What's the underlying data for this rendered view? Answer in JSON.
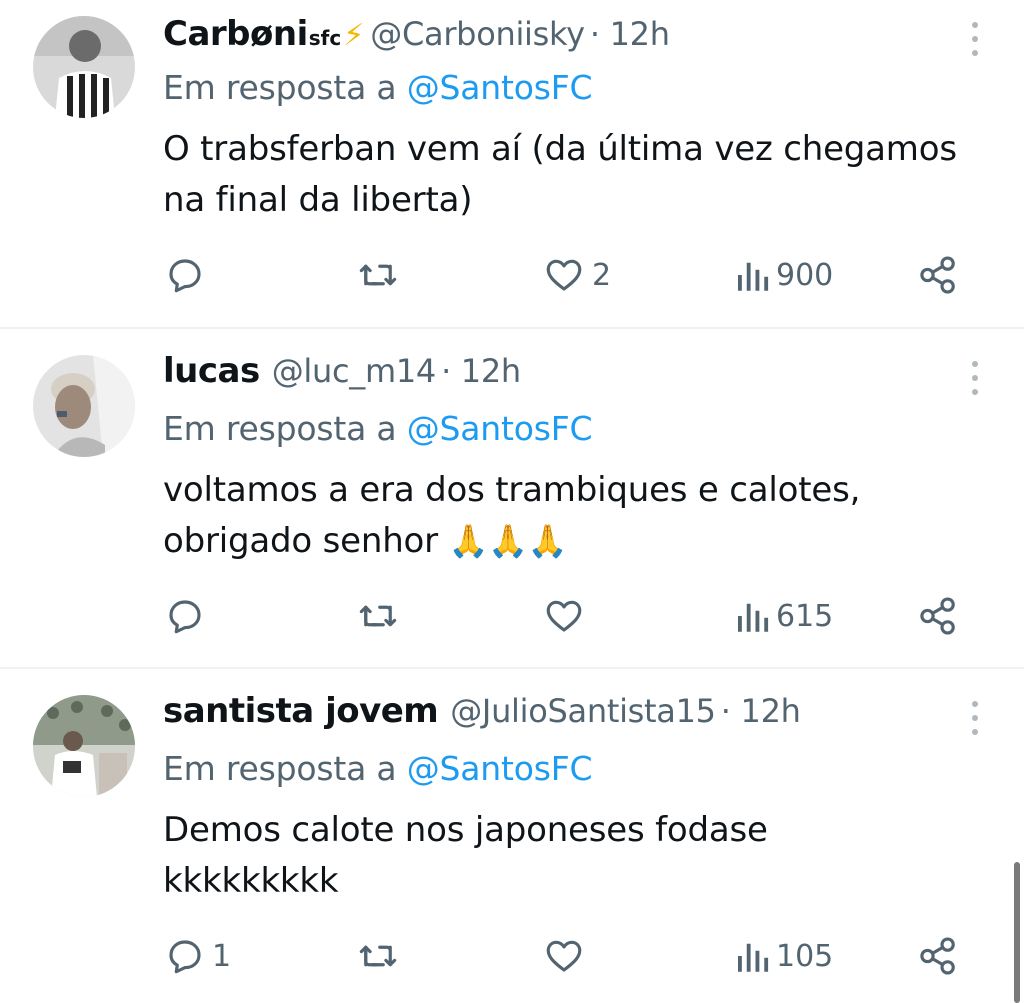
{
  "reply_prefix": "Em resposta a",
  "tweets": [
    {
      "name": "Carbøni",
      "name_sup": "sfc",
      "name_emoji": "⚡",
      "handle": "@Carboniisky",
      "time": "· 12h",
      "reply_to": "@SantosFC",
      "text": "O trabsferban vem aí (da última vez chegamos na final da liberta)",
      "replies": "",
      "retweets": "",
      "likes": "2",
      "views": "900"
    },
    {
      "name": "lucas",
      "handle": "@luc_m14",
      "time": "· 12h",
      "reply_to": "@SantosFC",
      "text": "voltamos a era dos trambiques e calotes, obrigado senhor",
      "text_emoji": "🙏🙏🙏",
      "replies": "",
      "retweets": "",
      "likes": "",
      "views": "615"
    },
    {
      "name": "santista jovem",
      "handle": "@JulioSantista15",
      "time": "· 12h",
      "reply_to": "@SantosFC",
      "text": "Demos calote nos japoneses fodase kkkkkkkkk",
      "replies": "1",
      "retweets": "",
      "likes": "",
      "views": "105"
    }
  ],
  "icons": [
    "reply-icon",
    "retweet-icon",
    "like-icon",
    "views-icon",
    "share-icon",
    "more-options-icon"
  ],
  "colors": {
    "mention": "#1d9bf0",
    "secondary": "#536471",
    "bolt": "#f5b800"
  }
}
